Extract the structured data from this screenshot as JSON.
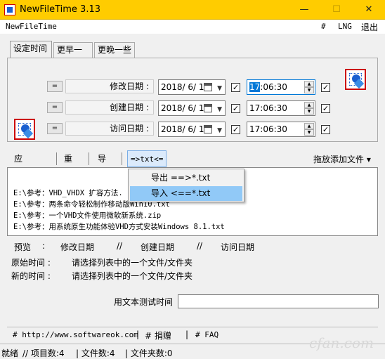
{
  "window": {
    "title": "NewFileTime 3.13",
    "minimize": "—",
    "maximize": "☐",
    "close": "✕"
  },
  "menubar": {
    "app_name": "NewFileTime",
    "hash": "#",
    "lng": "LNG",
    "exit": "退出"
  },
  "tabs": [
    {
      "label": "设定时间",
      "active": true
    },
    {
      "label": "更早一些"
    },
    {
      "label": "更晚一些"
    }
  ],
  "rows": [
    {
      "eq": "=",
      "label": "修改日期 :",
      "date": "2018/ 6/ 1",
      "date_checked": true,
      "time_selected": "17",
      "time_rest": ":06:30",
      "time_checked": true
    },
    {
      "eq": "=",
      "label": "创建日期 :",
      "date": "2018/ 6/ 1",
      "date_checked": true,
      "time_selected": "",
      "time_rest": "17:06:30",
      "time_checked": true
    },
    {
      "eq": "=",
      "label": "访问日期 :",
      "date": "2018/ 6/ 1",
      "date_checked": true,
      "time_selected": "",
      "time_rest": "17:06:30",
      "time_checked": true
    }
  ],
  "toolbar": {
    "apply": "应用时间",
    "reset": "重置",
    "import": "导入",
    "txt": "=>txt<=",
    "drag_add": "拖放添加文件 ▾"
  },
  "files": [
    "E:\\参考：VHD_VHDX 扩容方法.",
    "E:\\参考：两条命令轻松制作移动版Win10.txt",
    "E:\\参考：一个VHD文件使用微软新系统.zip",
    "E:\\参考：用系统原生功能体验VHD方式安装Windows 8.1.txt"
  ],
  "context_menu": [
    {
      "label": "导出 ==>*.txt",
      "highlighted": false
    },
    {
      "label": "导入 <==*.txt",
      "highlighted": true
    }
  ],
  "preview": {
    "label": "预览",
    "modify": "修改日期",
    "sep1": "//",
    "create": "创建日期",
    "sep2": "//",
    "access": "访问日期"
  },
  "original": {
    "label": "原始时间 :",
    "value": "请选择列表中的一个文件/文件夹"
  },
  "new": {
    "label": "新的时间 :",
    "value": "请选择列表中的一个文件/文件夹"
  },
  "test": {
    "label": "用文本测试时间",
    "value": ""
  },
  "footer": {
    "site": "# http://www.softwareok.com",
    "donate": "# 捐赠",
    "faq": "# FAQ"
  },
  "status": {
    "ready": "就绪",
    "items": "// 项目数:4",
    "files": "| 文件数:4",
    "folders": "| 文件夹数:0"
  },
  "watermark": "cfan.com"
}
